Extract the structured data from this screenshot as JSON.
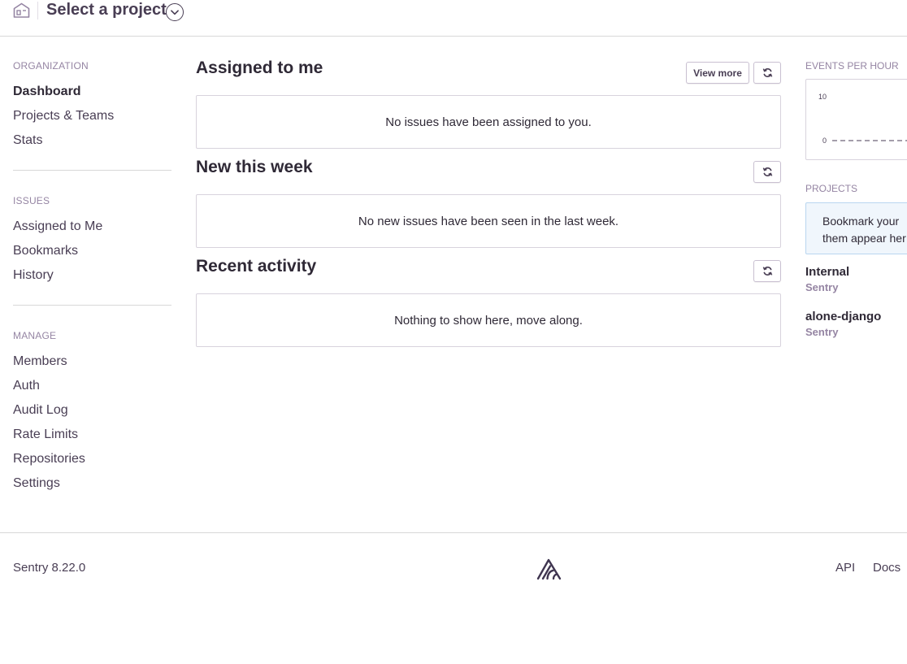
{
  "header": {
    "project_title": "Select a project",
    "home_icon": "home-icon",
    "chevron_icon": "chevron-down-icon"
  },
  "sidebar": {
    "sections": [
      {
        "title": "ORGANIZATION",
        "items": [
          "Dashboard",
          "Projects & Teams",
          "Stats"
        ],
        "active": "Dashboard"
      },
      {
        "title": "ISSUES",
        "items": [
          "Assigned to Me",
          "Bookmarks",
          "History"
        ]
      },
      {
        "title": "MANAGE",
        "items": [
          "Members",
          "Auth",
          "Audit Log",
          "Rate Limits",
          "Repositories",
          "Settings"
        ]
      }
    ]
  },
  "main": {
    "panels": [
      {
        "title": "Assigned to me",
        "view_more_label": "View more",
        "empty_text": "No issues have been assigned to you."
      },
      {
        "title": "New this week",
        "empty_text": "No new issues have been seen in the last week."
      },
      {
        "title": "Recent activity",
        "empty_text": "Nothing to show here, move along."
      }
    ],
    "refresh_icon": "refresh-icon"
  },
  "right": {
    "events_title": "EVENTS PER HOUR",
    "chart_ticks": [
      "10",
      "0"
    ],
    "projects_title": "PROJECTS",
    "bookmark_note_line1": "Bookmark your",
    "bookmark_note_line2": "them appear her",
    "projects": [
      {
        "name": "Internal",
        "org": "Sentry"
      },
      {
        "name": "alone-django",
        "org": "Sentry"
      }
    ]
  },
  "footer": {
    "version": "Sentry 8.22.0",
    "logo_icon": "sentry-logo-icon",
    "api_label": "API",
    "docs_label": "Docs"
  },
  "colors": {
    "text": "#2f2936",
    "muted": "#9585a3",
    "border": "#d8d8d8",
    "note_bg": "#f0f6fc"
  }
}
